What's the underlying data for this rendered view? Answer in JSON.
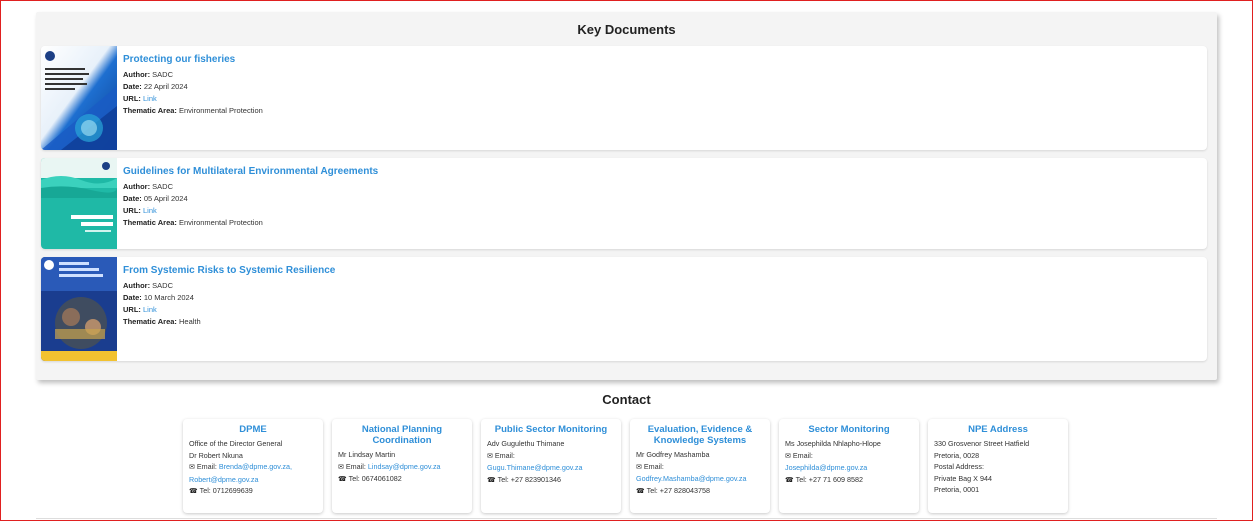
{
  "key_documents": {
    "title": "Key Documents",
    "labels": {
      "author": "Author:",
      "date": "Date:",
      "url": "URL:",
      "thematic": "Thematic Area:"
    },
    "items": [
      {
        "title": "Protecting our fisheries",
        "author": "SADC",
        "date": "22 April 2024",
        "url_text": "Link",
        "thematic_area": "Environmental Protection",
        "thumb_text": "From Systemic Risks to Systemic Resilience: Lessons from the COVID-19 Pandemic for Risk Management and Recovery in the SADC"
      },
      {
        "title": "Guidelines for Multilateral Environmental Agreements",
        "author": "SADC",
        "date": "05 April 2024",
        "url_text": "Link",
        "thematic_area": "Environmental Protection",
        "thumb_text": "Protecting our fisheries"
      },
      {
        "title": "From Systemic Risks to Systemic Resilience",
        "author": "SADC",
        "date": "10 March 2024",
        "url_text": "Link",
        "thematic_area": "Health",
        "thumb_text": "Guidelines for Multilateral Environmental Agreements"
      }
    ]
  },
  "contact": {
    "title": "Contact",
    "cards": [
      {
        "heading": "DPME",
        "lines": [
          "Office of the Director General",
          "Dr Robert Nkuna"
        ],
        "email_label": "Email:",
        "emails": [
          "Brenda@dpme.gov.za,",
          "Robert@dpme.gov.za"
        ],
        "tel": "Tel: 0712699639"
      },
      {
        "heading": "National Planning Coordination",
        "lines": [
          "Mr Lindsay Martin"
        ],
        "email_label": "Email:",
        "emails": [
          "Lindsay@dpme.gov.za"
        ],
        "tel": "Tel: 0674061082"
      },
      {
        "heading": "Public Sector Monitoring",
        "lines": [
          "Adv Gugulethu Thimane"
        ],
        "email_label": "Email:",
        "emails": [
          "Gugu.Thimane@dpme.gov.za"
        ],
        "tel": "Tel: +27 823901346"
      },
      {
        "heading": "Evaluation, Evidence & Knowledge Systems",
        "lines": [
          "Mr Godfrey Mashamba"
        ],
        "email_label": "Email:",
        "emails": [
          "Godfrey.Mashamba@dpme.gov.za"
        ],
        "tel": "Tel: +27 828043758"
      },
      {
        "heading": "Sector Monitoring",
        "lines": [
          "Ms Josephilda Nhlapho-Hlope"
        ],
        "email_label": "Email:",
        "emails": [
          "Josephilda@dpme.gov.za"
        ],
        "tel": "Tel: +27 71 609 8582"
      },
      {
        "heading": "NPE Address",
        "lines": [
          "330 Grosvenor Street Hatfield",
          "Pretoria, 0028",
          "Postal Address:",
          "Private Bag X 944",
          "Pretoria, 0001"
        ],
        "email_label": "",
        "emails": [],
        "tel": ""
      }
    ]
  },
  "colors": {
    "accent": "#2f8fd8",
    "frame": "#e02020"
  }
}
